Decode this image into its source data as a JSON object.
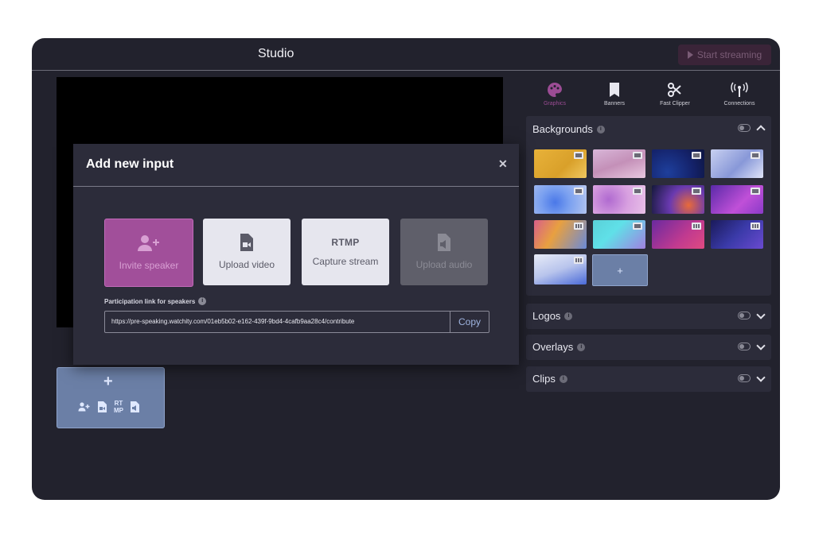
{
  "header": {
    "title": "Studio",
    "start_streaming_label": "Start streaming"
  },
  "modal": {
    "title": "Add new input",
    "options": [
      {
        "label": "Invite speaker",
        "icon": "user-plus-icon"
      },
      {
        "label": "Upload video",
        "icon": "video-file-icon"
      },
      {
        "label": "Capture stream",
        "icon_text": "RTMP"
      },
      {
        "label": "Upload audio",
        "icon": "audio-file-icon"
      }
    ],
    "link_label": "Participation link for speakers",
    "link_value": "https://pre-speaking.watchity.com/01eb5b02-e162-439f-9bd4-4cafb9aa28c4/contribute",
    "copy_label": "Copy"
  },
  "add_tile": {
    "rtmp_line1": "RT",
    "rtmp_line2": "MP"
  },
  "panel": {
    "tabs": [
      {
        "label": "Graphics",
        "icon": "palette-icon",
        "active": true
      },
      {
        "label": "Banners",
        "icon": "bookmark-icon"
      },
      {
        "label": "Fast Clipper",
        "icon": "scissors-icon"
      },
      {
        "label": "Connections",
        "icon": "antenna-icon"
      }
    ],
    "sections": {
      "backgrounds": "Backgrounds",
      "logos": "Logos",
      "overlays": "Overlays",
      "clips": "Clips"
    },
    "add_background_label": "+"
  },
  "colors": {
    "accent": "#a14f9a",
    "panel": "#2c2c3a",
    "app_bg": "#22222d",
    "add_tile": "#6b7fa6"
  }
}
